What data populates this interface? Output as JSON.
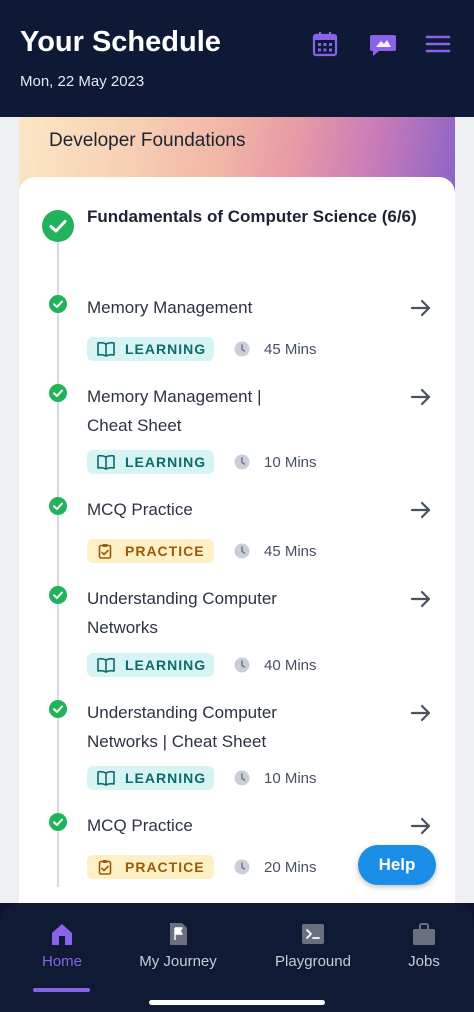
{
  "header": {
    "title": "Your Schedule",
    "date": "Mon, 22 May 2023",
    "icons": [
      "calendar-icon",
      "chat-icon",
      "menu-icon"
    ]
  },
  "section": {
    "title": "Developer Foundations"
  },
  "course": {
    "title": "Fundamentals of Computer Science (6/6)"
  },
  "items": [
    {
      "title": "Memory Management",
      "type": "LEARNING",
      "duration": "45 Mins"
    },
    {
      "title": "Memory Management | Cheat Sheet",
      "type": "LEARNING",
      "duration": "10 Mins"
    },
    {
      "title": "MCQ Practice",
      "type": "PRACTICE",
      "duration": "45 Mins"
    },
    {
      "title": "Understanding Computer Networks",
      "type": "LEARNING",
      "duration": "40 Mins"
    },
    {
      "title": "Understanding Computer Networks | Cheat Sheet",
      "type": "LEARNING",
      "duration": "10 Mins"
    },
    {
      "title": "MCQ Practice",
      "type": "PRACTICE",
      "duration": "20 Mins"
    }
  ],
  "help_label": "Help",
  "nav": [
    {
      "label": "Home",
      "active": true
    },
    {
      "label": "My Journey"
    },
    {
      "label": "Playground"
    },
    {
      "label": "Jobs"
    }
  ],
  "colors": {
    "accent": "#8a63e8",
    "success": "#22b25a",
    "learning_bg": "#d6f4f3",
    "practice_bg": "#fdf0c4"
  }
}
